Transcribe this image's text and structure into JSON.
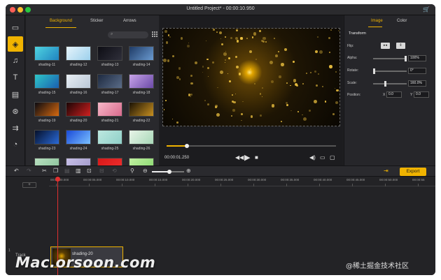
{
  "window": {
    "title": "Untitled Project* - 00:00:10.950",
    "traffic_colors": [
      "#fc5f57",
      "#fdbc2e",
      "#28c840"
    ],
    "cart_icon": "cart-icon"
  },
  "sidebar": {
    "items": [
      {
        "name": "folder-icon",
        "glyph": "▭"
      },
      {
        "name": "layers-icon",
        "glyph": "◈"
      },
      {
        "name": "audio-icon",
        "glyph": "♫"
      },
      {
        "name": "text-icon",
        "glyph": "T"
      },
      {
        "name": "layout-icon",
        "glyph": "▤"
      },
      {
        "name": "filters-icon",
        "glyph": "⊛"
      },
      {
        "name": "transitions-icon",
        "glyph": "⇉"
      },
      {
        "name": "elements-icon",
        "glyph": "◔"
      }
    ]
  },
  "library": {
    "tabs": [
      "Background",
      "Sticker",
      "Arrows"
    ],
    "active_tab": "Background",
    "search_placeholder": "Search",
    "thumbs": [
      {
        "label": "shading-11",
        "bg": "linear-gradient(135deg,#4fd3e0,#1f84c0)"
      },
      {
        "label": "shading-12",
        "bg": "linear-gradient(135deg,#e6f4fb,#9cd0ec)"
      },
      {
        "label": "shading-13",
        "bg": "linear-gradient(135deg,#0d0d14,#2f2f3a)"
      },
      {
        "label": "shading-14",
        "bg": "linear-gradient(135deg,#1f3b66,#6a9ad0)"
      },
      {
        "label": "shading-15",
        "bg": "linear-gradient(135deg,#2ec6c8,#1a5fb0)"
      },
      {
        "label": "shading-16",
        "bg": "linear-gradient(135deg,#e8eef4,#b9c7d6)"
      },
      {
        "label": "shading-17",
        "bg": "linear-gradient(135deg,#1e2a40,#5a6c88)"
      },
      {
        "label": "shading-18",
        "bg": "linear-gradient(135deg,#c7a4e8,#6b4aa8)"
      },
      {
        "label": "shading-19",
        "bg": "linear-gradient(135deg,#0a0a10,#d86a10)"
      },
      {
        "label": "shading-20",
        "bg": "linear-gradient(135deg,#1a0505,#d02020)"
      },
      {
        "label": "shading-21",
        "bg": "linear-gradient(135deg,#f7b8c8,#d86a8c)"
      },
      {
        "label": "shading-22",
        "bg": "linear-gradient(135deg,#1a1205,#c89020)"
      },
      {
        "label": "shading-23",
        "bg": "linear-gradient(135deg,#05102a,#2a6ad8)"
      },
      {
        "label": "shading-24",
        "bg": "linear-gradient(135deg,#1a4ad8,#7ac0ff)"
      },
      {
        "label": "shading-25",
        "bg": "linear-gradient(135deg,#bde8e0,#8fd0c8)"
      },
      {
        "label": "shading-26",
        "bg": "linear-gradient(135deg,#e8f4e8,#a8d8b8)"
      },
      {
        "label": "",
        "bg": "linear-gradient(135deg,#b8e0c0,#88c098)"
      },
      {
        "label": "",
        "bg": "linear-gradient(135deg,#c8c0e8,#a098c8)"
      },
      {
        "label": "",
        "bg": "linear-gradient(135deg,#d81818,#f03030)"
      },
      {
        "label": "",
        "bg": "linear-gradient(135deg,#c0f0a0,#88d870)"
      }
    ]
  },
  "preview": {
    "current_time": "00:00:01.250",
    "progress": 0.12,
    "controls": [
      "rewind-icon",
      "play-icon",
      "stop-icon"
    ],
    "right_controls": [
      "volume-icon",
      "screenshot-icon",
      "fullscreen-icon"
    ]
  },
  "props": {
    "tabs": [
      "Image",
      "Color"
    ],
    "active_tab": "Image",
    "section": "Transform",
    "flip_label": "Flip:",
    "alpha_label": "Alpha:",
    "alpha_value": "100%",
    "alpha_level": 1.0,
    "rotate_label": "Rotate:",
    "rotate_value": "0°",
    "rotate_level": 0.0,
    "scale_label": "Scale:",
    "scale_value": "160.0%",
    "scale_level": 0.35,
    "position_label": "Position:",
    "x_label": "X",
    "x_value": "0.0",
    "y_label": "Y",
    "y_value": "0.0"
  },
  "toolbar": {
    "export_label": "Export",
    "zoom_level": 0.55
  },
  "timeline": {
    "ticks": [
      "00:00:00.000",
      "00:00:05.000",
      "00:00:10.000",
      "00:00:15.000",
      "00:00:20.000",
      "00:00:25.000",
      "00:00:30.000",
      "00:00:35.000",
      "00:00:40.000",
      "00:00:45.000",
      "00:00:50.000",
      "00:00:55"
    ],
    "add_track": "+",
    "track_number": "1",
    "track_label": "Track",
    "clip_label": "shading-20"
  },
  "watermark": {
    "left": "Mac.orsoon.com",
    "right": "@稀土掘金技术社区"
  }
}
